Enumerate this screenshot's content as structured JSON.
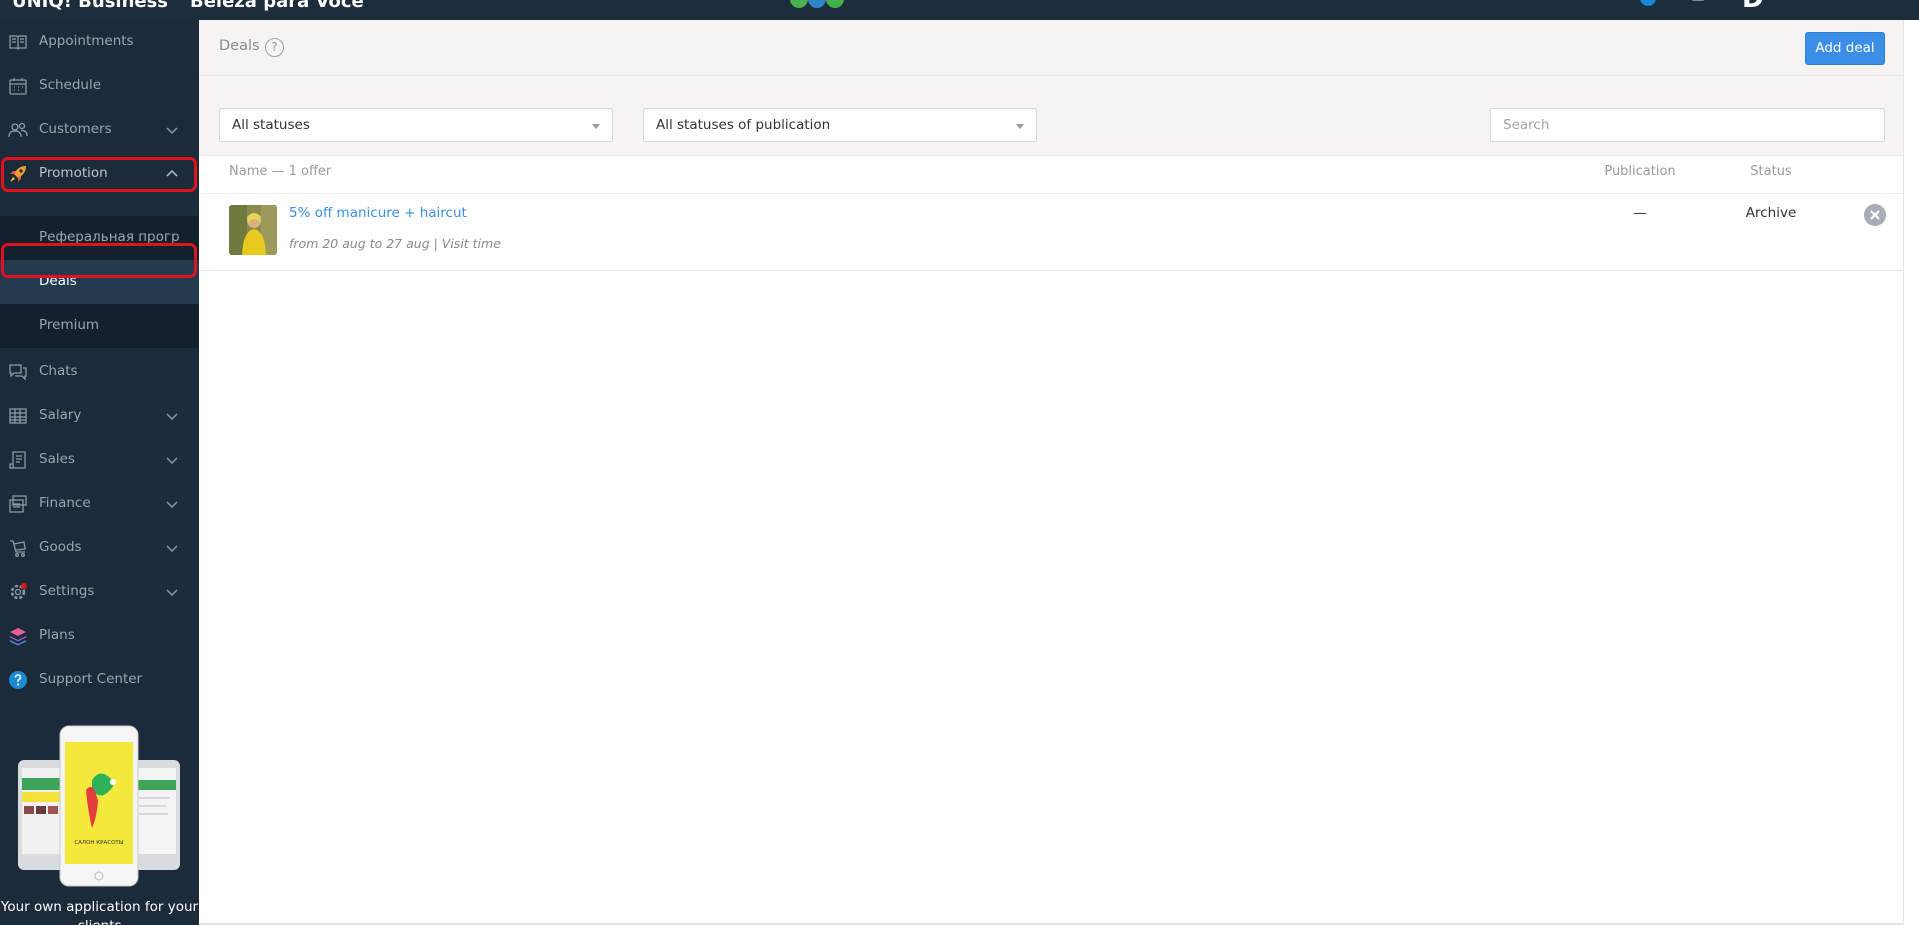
{
  "topbar": {
    "brand": "UNIQ! Business",
    "salon": "Beleza para Voce"
  },
  "sidebar": {
    "items": [
      {
        "label": "Appointments",
        "icon": "book-icon"
      },
      {
        "label": "Schedule",
        "icon": "calendar-icon"
      },
      {
        "label": "Customers",
        "icon": "users-icon"
      },
      {
        "label": "Promotion",
        "icon": "rocket-icon"
      },
      {
        "label": "Chats",
        "icon": "chat-icon"
      },
      {
        "label": "Salary",
        "icon": "spreadsheet-icon"
      },
      {
        "label": "Sales",
        "icon": "receipt-icon"
      },
      {
        "label": "Finance",
        "icon": "cash-icon"
      },
      {
        "label": "Goods",
        "icon": "cart-icon"
      },
      {
        "label": "Settings",
        "icon": "gear-icon"
      },
      {
        "label": "Plans",
        "icon": "layers-icon"
      },
      {
        "label": "Support Center",
        "icon": "help-icon"
      }
    ],
    "promotion_sub": [
      {
        "label": "Реферальная прогр"
      },
      {
        "label": "Deals"
      },
      {
        "label": "Premium"
      }
    ],
    "promo_text": "Your own application for your clients",
    "promo_phone_text": "САЛОН КРАСОТЫ"
  },
  "page": {
    "title": "Deals",
    "help_glyph": "?",
    "add_button": "Add deal"
  },
  "filters": {
    "status_select": "All statuses",
    "publication_select": "All statuses of publication",
    "search_placeholder": "Search"
  },
  "table": {
    "columns": {
      "name": "Name — 1 offer",
      "publication": "Publication",
      "status": "Status"
    },
    "rows": [
      {
        "title": "5% off manicure + haircut",
        "meta": "from 20 aug to 27 aug | Visit time",
        "publication": "—",
        "status": "Archive"
      }
    ]
  },
  "colors": {
    "sidebar_bg": "#1b2b3a",
    "accent": "#3a8ee6",
    "highlight": "#e0121d"
  }
}
